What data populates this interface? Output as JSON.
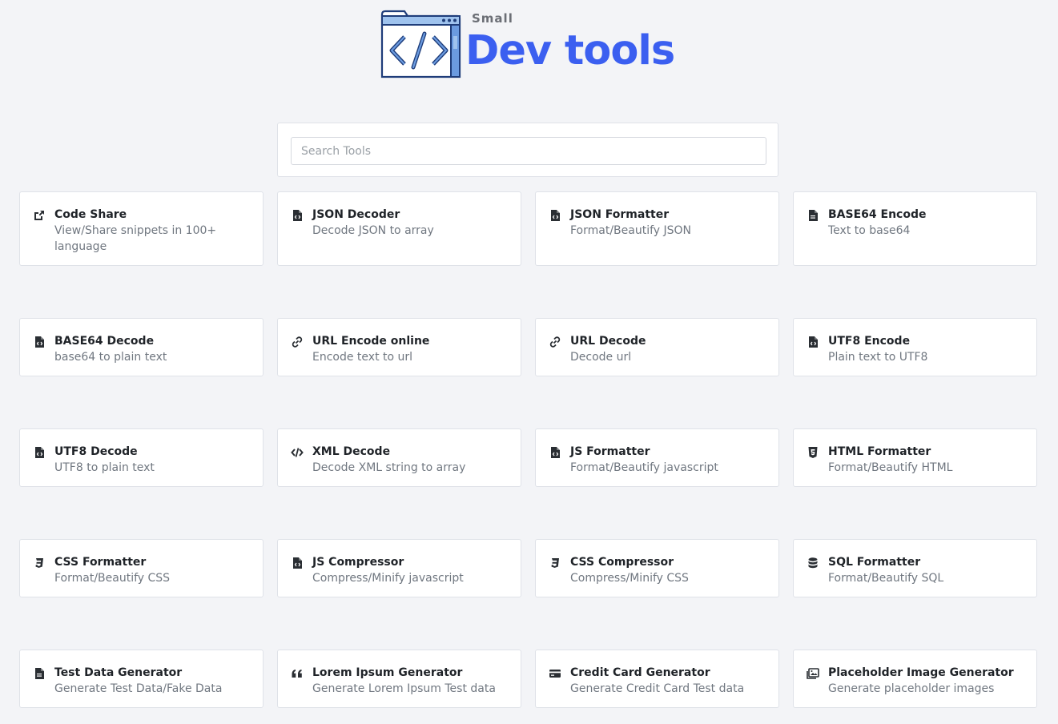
{
  "logo": {
    "small": "Small",
    "main": "Dev tools"
  },
  "search": {
    "placeholder": "Search Tools",
    "value": ""
  },
  "tools": [
    {
      "title": "Code Share",
      "desc": "View/Share snippets in 100+ language",
      "icon": "share-square-icon"
    },
    {
      "title": "JSON Decoder",
      "desc": "Decode JSON to array",
      "icon": "file-code-icon"
    },
    {
      "title": "JSON Formatter",
      "desc": "Format/Beautify JSON",
      "icon": "file-code-icon"
    },
    {
      "title": "BASE64 Encode",
      "desc": "Text to base64",
      "icon": "file-text-icon"
    },
    {
      "title": "BASE64 Decode",
      "desc": "base64 to plain text",
      "icon": "file-code-icon"
    },
    {
      "title": "URL Encode online",
      "desc": "Encode text to url",
      "icon": "link-icon"
    },
    {
      "title": "URL Decode",
      "desc": "Decode url",
      "icon": "link-icon"
    },
    {
      "title": "UTF8 Encode",
      "desc": "Plain text to UTF8",
      "icon": "file-code-icon"
    },
    {
      "title": "UTF8 Decode",
      "desc": "UTF8 to plain text",
      "icon": "file-code-icon"
    },
    {
      "title": "XML Decode",
      "desc": "Decode XML string to array",
      "icon": "code-icon"
    },
    {
      "title": "JS Formatter",
      "desc": "Format/Beautify javascript",
      "icon": "file-code-icon"
    },
    {
      "title": "HTML Formatter",
      "desc": "Format/Beautify HTML",
      "icon": "html5-icon"
    },
    {
      "title": "CSS Formatter",
      "desc": "Format/Beautify CSS",
      "icon": "css3-icon"
    },
    {
      "title": "JS Compressor",
      "desc": "Compress/Minify javascript",
      "icon": "file-code-icon"
    },
    {
      "title": "CSS Compressor",
      "desc": "Compress/Minify CSS",
      "icon": "css3-icon"
    },
    {
      "title": "SQL Formatter",
      "desc": "Format/Beautify SQL",
      "icon": "database-icon"
    },
    {
      "title": "Test Data Generator",
      "desc": "Generate Test Data/Fake Data",
      "icon": "file-text-icon"
    },
    {
      "title": "Lorem Ipsum Generator",
      "desc": "Generate Lorem Ipsum Test data",
      "icon": "quote-icon"
    },
    {
      "title": "Credit Card Generator",
      "desc": "Generate Credit Card Test data",
      "icon": "credit-card-icon"
    },
    {
      "title": "Placeholder Image Generator",
      "desc": "Generate placeholder images",
      "icon": "images-icon"
    }
  ],
  "colors": {
    "brand": "#3b5ff0",
    "background": "#f3f4f7"
  }
}
